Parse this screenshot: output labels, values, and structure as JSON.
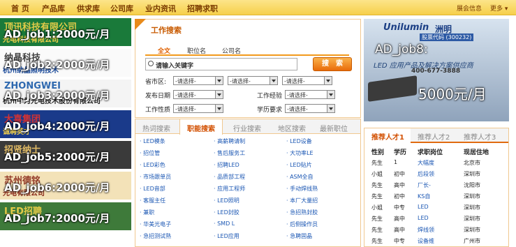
{
  "nav": {
    "items": [
      "首 页",
      "产品库",
      "供求库",
      "公司库",
      "业内资讯",
      "招聘求职"
    ],
    "right": [
      "展会信息",
      "更多"
    ]
  },
  "left_ads": [
    {
      "label": "AD_job1:2000元/月",
      "logo": "顶讯科技有限公司",
      "sub": "光电科技有限公司",
      "bg": "#1a7a3a",
      "logo_color": "#f7d44b",
      "sub_color": "#f7d44b"
    },
    {
      "label": "AD_job2:2000元/月",
      "logo": "纳晶科技",
      "sub": "杭州纳晶照明技术",
      "bg": "#fafafa",
      "logo_color": "#2a2a2a",
      "sub_color": "#1a4a9a"
    },
    {
      "label": "AD_job3:2000元/月",
      "logo": "ZHONGWEI",
      "sub": "杭州中为光电技术股份有限公司",
      "bg": "#f4f4f4",
      "logo_color": "#1a5aa8",
      "sub_color": "#222"
    },
    {
      "label": "AD_job4:2000元/月",
      "logo": "大喜集团",
      "sub": "诚聘英才",
      "bg": "#1a3a8a",
      "logo_color": "#e8322a",
      "sub_color": "#f7d44b"
    },
    {
      "label": "AD_job5:2000元/月",
      "logo": "招贤纳士",
      "sub": "",
      "bg": "#3a3a3a",
      "logo_color": "#f2c86a",
      "sub_color": "#fff"
    },
    {
      "label": "AD_job6:2000元/月",
      "logo": "苏州德铭",
      "sub": "光电有限公司",
      "bg": "#f3e2b8",
      "logo_color": "#8a2a1a",
      "sub_color": "#8a2a1a"
    },
    {
      "label": "AD_job7:2000元/月",
      "logo": "LED招聘",
      "sub": "",
      "bg": "#3e7a3a",
      "logo_color": "#f7d44b",
      "sub_color": "#fff"
    }
  ],
  "search": {
    "title": "工作搜索",
    "tabs": [
      "全文",
      "职位名",
      "公司名"
    ],
    "keyword_placeholder": "请输入关键字",
    "button": "搜　索",
    "province_label": "省市区:",
    "date_label": "发布日期",
    "exp_label": "工作经验",
    "nature_label": "工作性质",
    "edu_label": "学历要求",
    "select_placeholder": "-请选择-"
  },
  "categories": {
    "tabs": [
      "热词搜索",
      "职能搜索",
      "行业搜索",
      "地区搜索",
      "最新职位"
    ],
    "items": [
      [
        "LED模条",
        "高薪聘请制",
        "LED设备"
      ],
      [
        "招位管",
        "售后服务工",
        "大功率LE"
      ],
      [
        "LED彩色",
        "招聘LED",
        "LED贴片"
      ],
      [
        "市场跟单员",
        "品质部工程",
        "ASM全自"
      ],
      [
        "LED音部",
        "应用工程师",
        "手动焊线熟"
      ],
      [
        "客服主任",
        "LED照明",
        "本厂大量招"
      ],
      [
        "兼职",
        "LED封胶",
        "急招熟封胶"
      ],
      [
        "华美光电子",
        "SMD L",
        "后侧操作员"
      ],
      [
        "急招测试熟",
        "LED应用",
        "急聘固晶"
      ]
    ]
  },
  "right_ad": {
    "brand": "Unilumin",
    "brand_cn": "洲明",
    "stock": "股票代码 (300232)",
    "slogan": "LED 应用产品及解决方案供应商",
    "phone": "400-677-3888",
    "label1": "AD_job8:",
    "label2": "5000元/月"
  },
  "talent": {
    "tabs": [
      "推荐人才1",
      "推荐人才2",
      "推荐人才3"
    ],
    "headers": [
      "性别",
      "学历",
      "求职岗位",
      "现居住地"
    ],
    "rows": [
      [
        "先生",
        "1",
        "大幅度",
        "北京市"
      ],
      [
        "小姐",
        "初中",
        "后段领",
        "深圳市"
      ],
      [
        "先生",
        "高中",
        "厂长-",
        "沈阳市"
      ],
      [
        "先生",
        "初中",
        "KS自",
        "深圳市"
      ],
      [
        "小姐",
        "中专",
        "LED",
        "深圳市"
      ],
      [
        "先生",
        "高中",
        "LED",
        "深圳市"
      ],
      [
        "先生",
        "高中",
        "焊线领",
        "深圳市"
      ],
      [
        "先生",
        "中专",
        "设备维",
        "广州市"
      ]
    ]
  },
  "colors": {
    "accent": "#e06a10",
    "link": "#1a56b3",
    "nav_bg": "#f6cf4a"
  }
}
